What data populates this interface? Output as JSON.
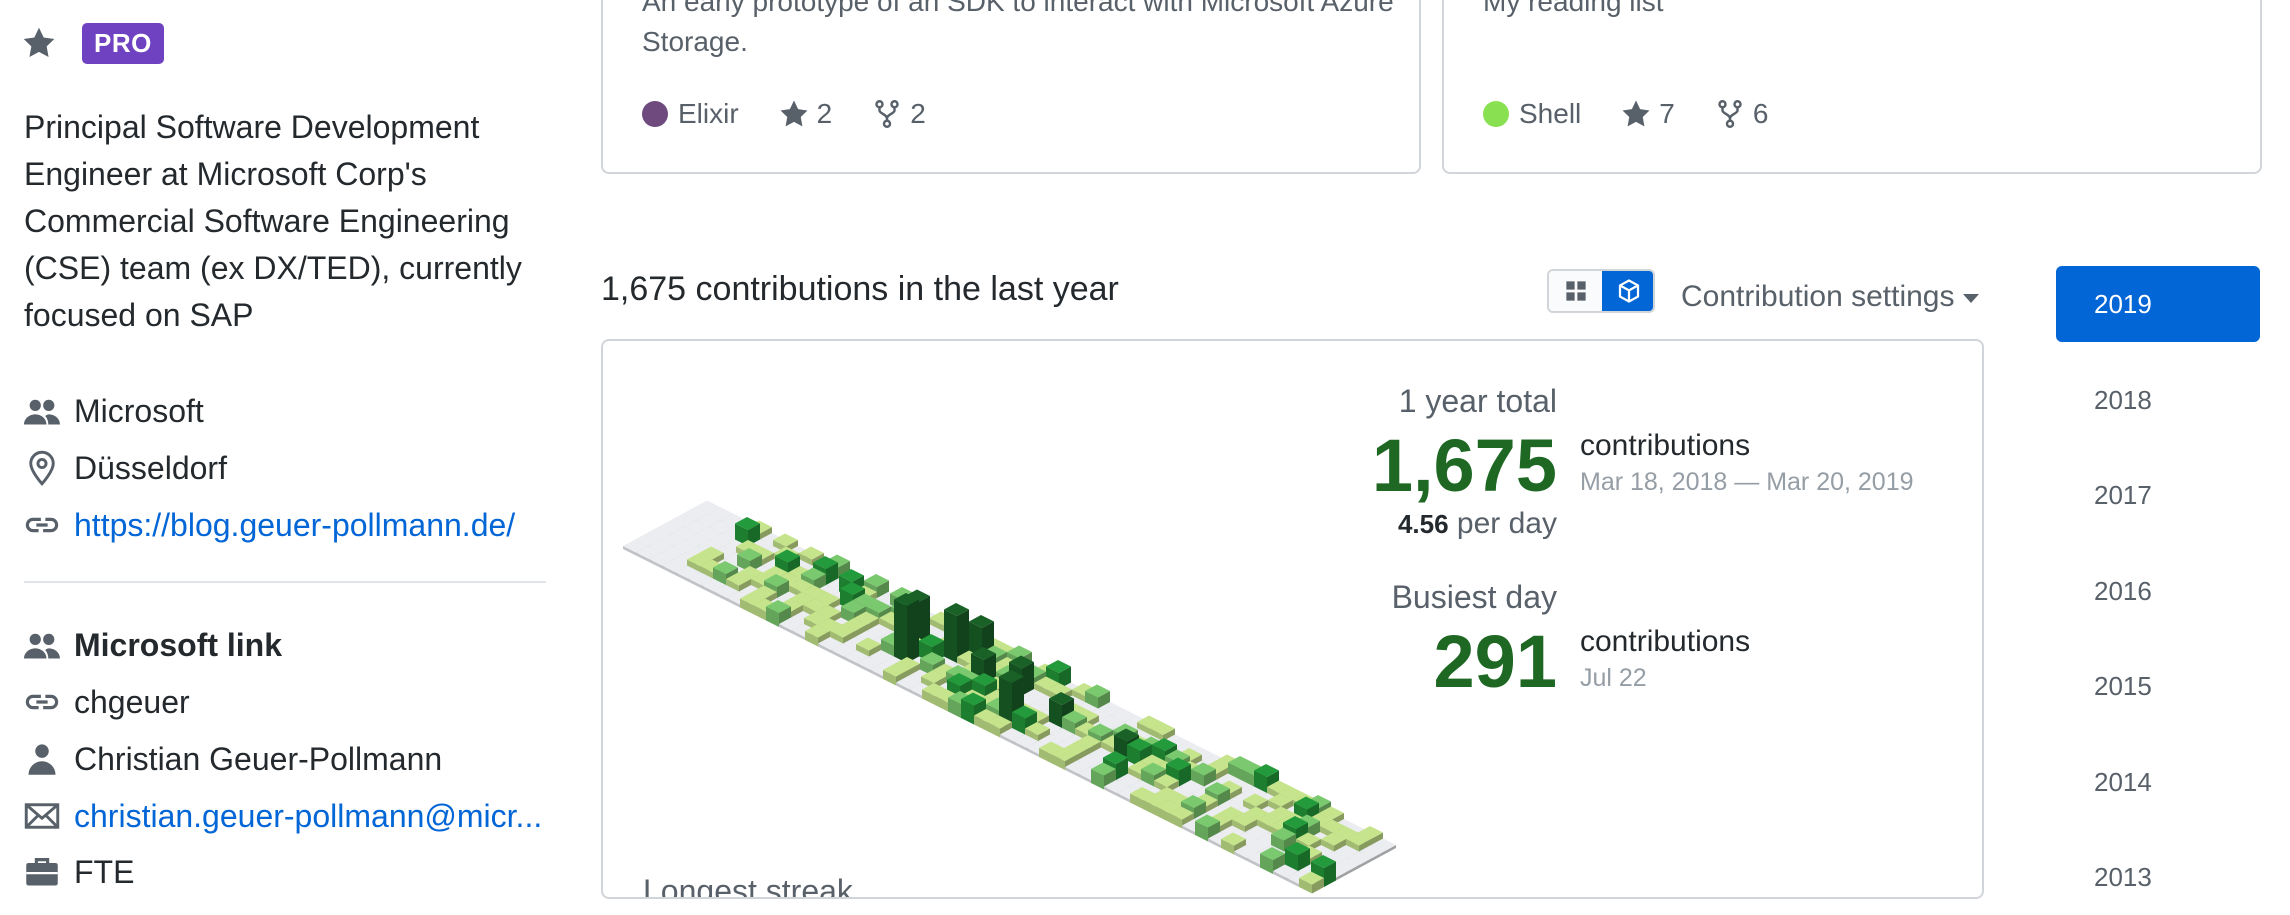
{
  "profile": {
    "badge": "PRO",
    "bio": "Principal Software Development Engineer at Microsoft Corp's Commercial Software Engineering (CSE) team (ex DX/TED), currently focused on SAP",
    "company": "Microsoft",
    "location": "Düsseldorf",
    "website": "https://blog.geuer-pollmann.de/",
    "org_link": "Microsoft link",
    "org_username": "chgeuer",
    "org_name": "Christian Geuer-Pollmann",
    "org_email": "christian.geuer-pollmann@micr...",
    "org_type": "FTE"
  },
  "pinned": [
    {
      "description": "An early prototype of an SDK to interact with Microsoft Azure Storage.",
      "language": "Elixir",
      "language_color": "#6e4a7e",
      "stars": "2",
      "forks": "2"
    },
    {
      "description": "My reading list",
      "language": "Shell",
      "language_color": "#89e051",
      "stars": "7",
      "forks": "6"
    }
  ],
  "contributions": {
    "title": "1,675 contributions in the last year",
    "settings_label": "Contribution settings",
    "year_total_label": "1 year total",
    "year_total": "1,675",
    "contributions_word": "contributions",
    "date_range": "Mar 18, 2018 — Mar 20, 2019",
    "per_day_value": "4.56",
    "per_day_label": "per day",
    "busiest_label": "Busiest day",
    "busiest_value": "291",
    "busiest_date": "Jul 22",
    "longest_label": "Longest streak",
    "colors": {
      "empty": "#ebedf0",
      "l1": "#c6e48b",
      "l2": "#7bc96f",
      "l3": "#239a3b",
      "l4": "#196127"
    }
  },
  "years": [
    "2019",
    "2018",
    "2017",
    "2016",
    "2015",
    "2014",
    "2013"
  ],
  "icons": {
    "star": "star-icon",
    "people": "people-icon",
    "location": "location-icon",
    "link": "link-icon",
    "person": "person-icon",
    "mail": "mail-icon",
    "briefcase": "briefcase-icon",
    "fork": "fork-icon",
    "grid": "grid-icon",
    "cube": "cube-icon"
  }
}
